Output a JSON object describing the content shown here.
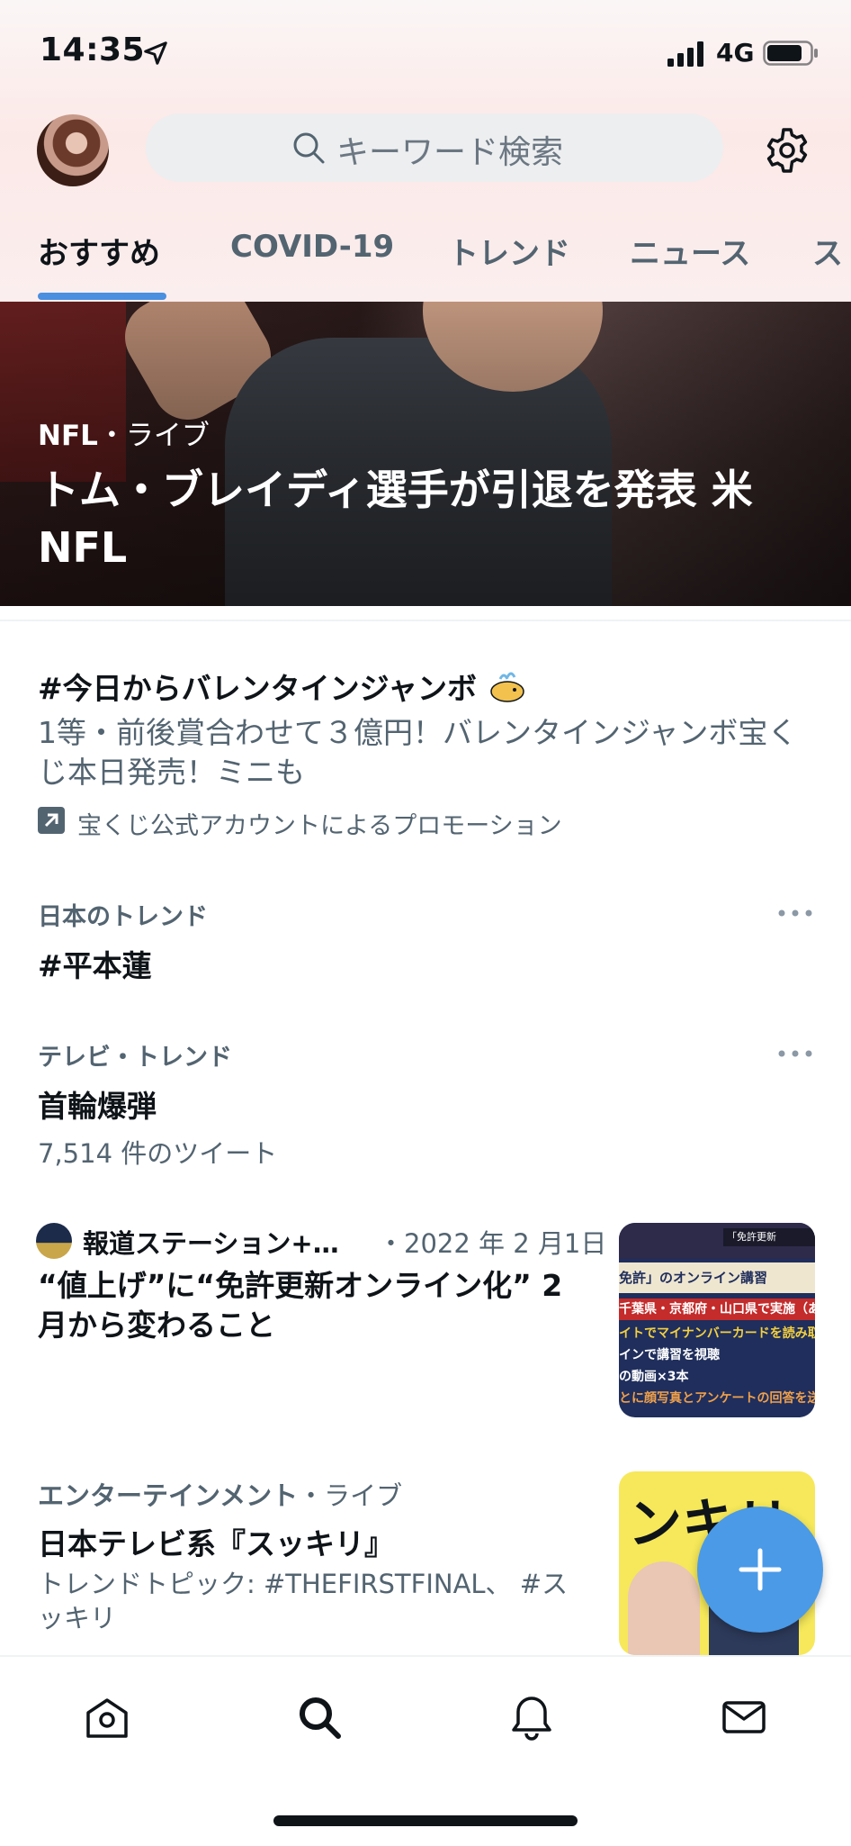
{
  "status_bar": {
    "time": "14:35",
    "network": "4G"
  },
  "search": {
    "placeholder": "キーワード検索"
  },
  "tabs": [
    "おすすめ",
    "COVID-19",
    "トレンド",
    "ニュース",
    "ス"
  ],
  "hero": {
    "category": "NFL",
    "status": "・ライブ",
    "title": "トム・ブレイディ選手が引退を発表 米NFL"
  },
  "promoted": {
    "title": "#今日からバレンタインジャンボ",
    "body": "1等・前後賞合わせて３億円！バレンタインジャンボ宝くじ本日発売！ミニも",
    "promotion": "宝くじ公式アカウントによるプロモーション"
  },
  "trends": [
    {
      "context": "日本のトレンド",
      "title": "#平本蓮",
      "count": ""
    },
    {
      "context": "テレビ・トレンド",
      "title": "首輪爆弾",
      "count": "7,514 件のツイート"
    }
  ],
  "news": {
    "source": "報道ステーション+…",
    "date": "・2022 年 2 月1日",
    "title": "“値上げ”に“免許更新オンライン化” 2月から変わること"
  },
  "entertainment": {
    "category": "エンターテインメント",
    "status": "・ライブ",
    "title": "日本テレビ系『スッキリ』",
    "body": "トレンドトピック: #THEFIRSTFINAL、 #スッキリ"
  },
  "news_thumb_text": [
    "「免許更新",
    "免許」のオンライン講習",
    "千葉県・京都府・山口県で実施（あす〜",
    "イトでマイナンバーカードを読み取る",
    "インで講習を視聴",
    "の動画×3本",
    "とに顔写真とアンケートの回答を送付"
  ],
  "ent_thumb_text": "ンキリ",
  "colors": {
    "accent": "#1d9bf0",
    "tab_indicator": "#4a8fe0",
    "fab": "#4a9ae8",
    "muted": "#536471"
  }
}
